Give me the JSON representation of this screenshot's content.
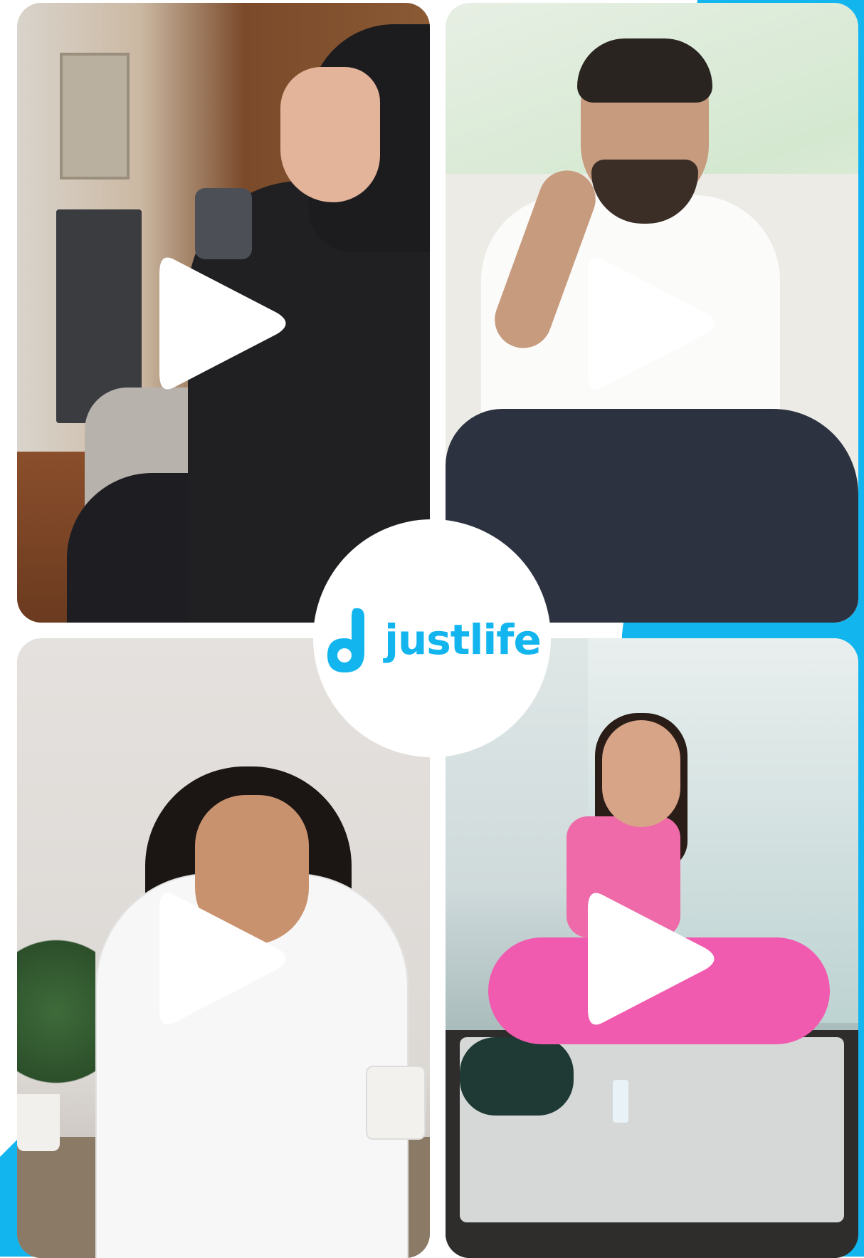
{
  "brand": {
    "name": "justlife",
    "color": "#12b5ee",
    "icon": "justlife-logo-mark-icon"
  },
  "background": {
    "accent_color": "#12b5ee",
    "base_color": "#ffffff"
  },
  "videos": [
    {
      "id": "video-1",
      "icon": "play-icon"
    },
    {
      "id": "video-2",
      "icon": "play-icon"
    },
    {
      "id": "video-3",
      "icon": "play-icon"
    },
    {
      "id": "video-4",
      "icon": "play-icon"
    }
  ],
  "play_icon_color": "#ffffff"
}
